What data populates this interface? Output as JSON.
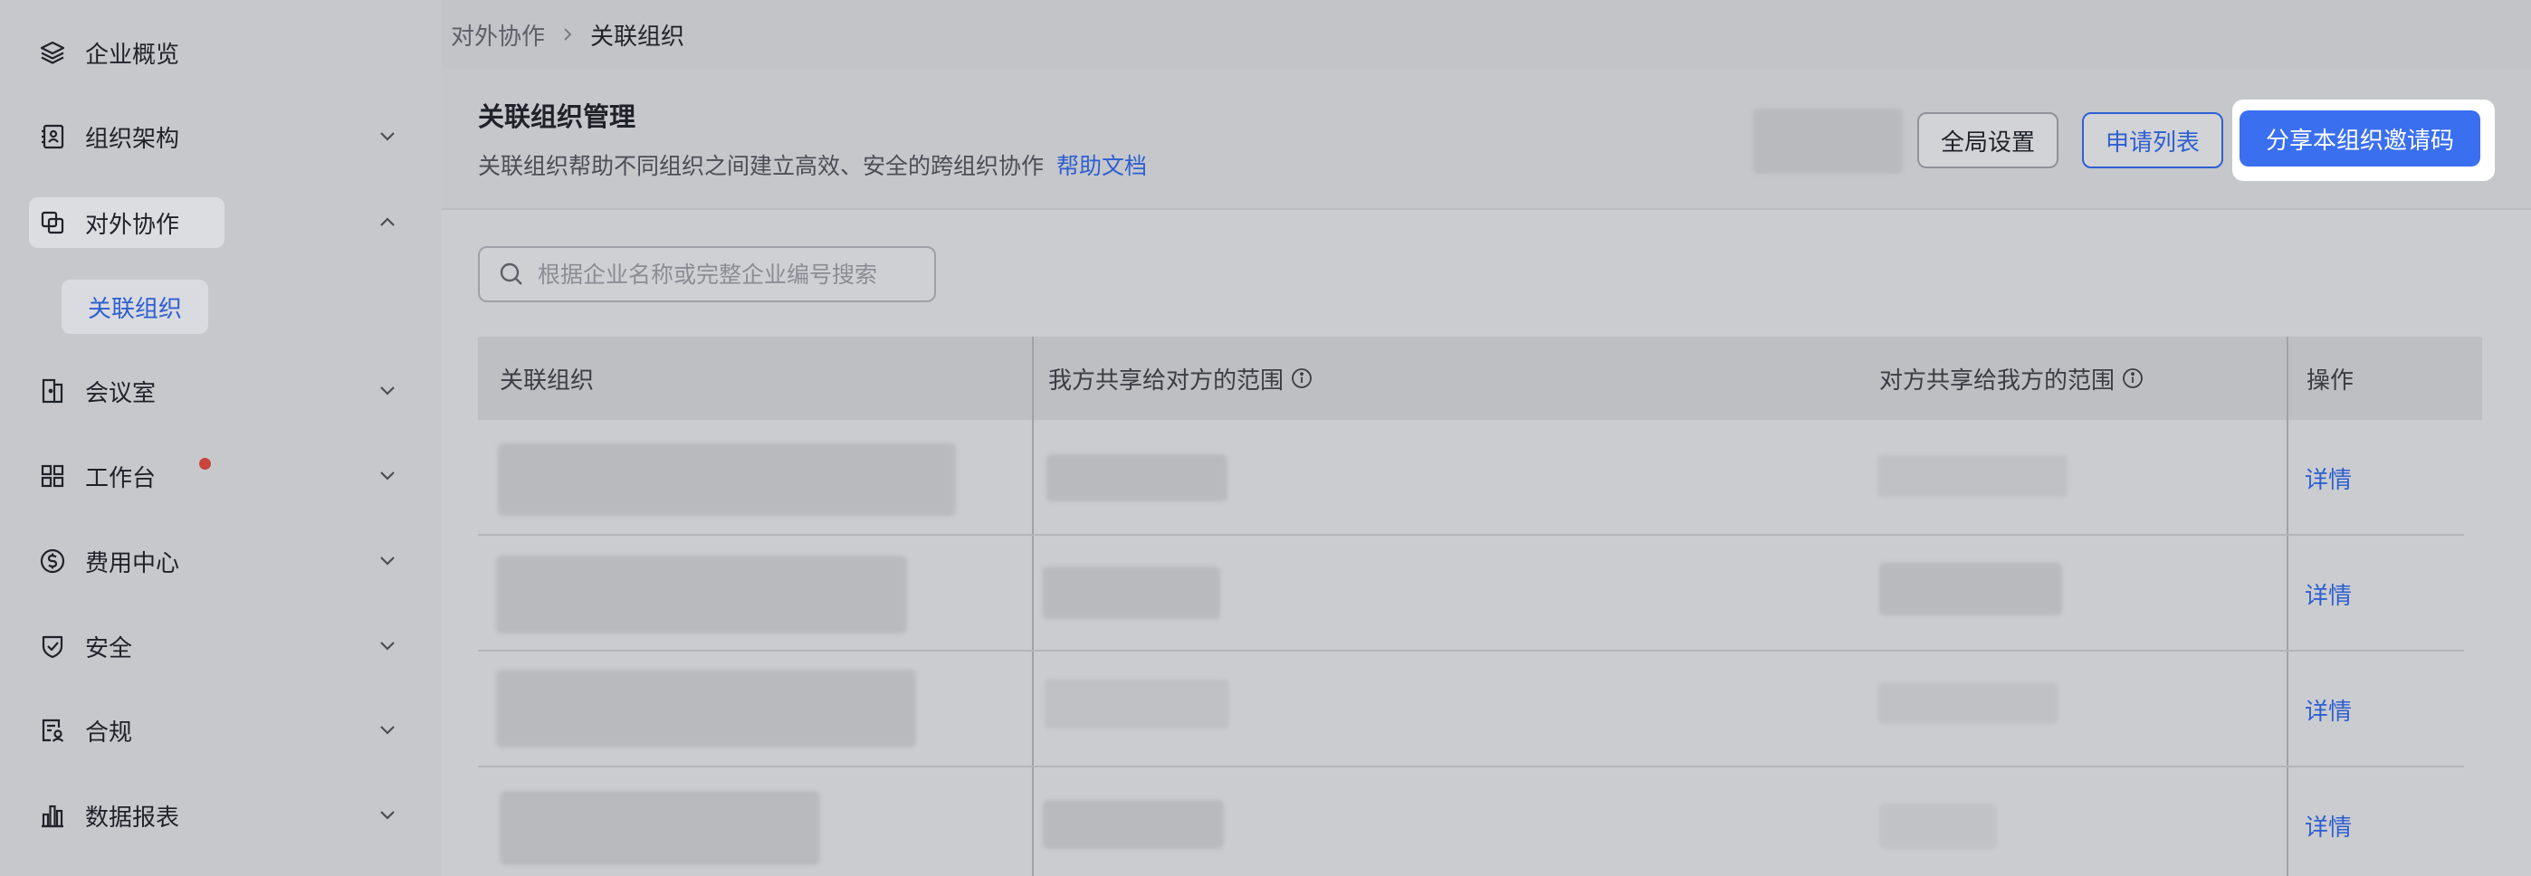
{
  "sidebar": {
    "items": [
      {
        "label": "企业概览",
        "icon": "layers-icon"
      },
      {
        "label": "组织架构",
        "icon": "org-chart-icon"
      },
      {
        "label": "对外协作",
        "icon": "collaboration-icon"
      },
      {
        "label": "会议室",
        "icon": "meeting-room-icon"
      },
      {
        "label": "工作台",
        "icon": "grid-apps-icon"
      },
      {
        "label": "费用中心",
        "icon": "dollar-coin-icon"
      },
      {
        "label": "安全",
        "icon": "shield-check-icon"
      },
      {
        "label": "合规",
        "icon": "compliance-doc-icon"
      },
      {
        "label": "数据报表",
        "icon": "bar-chart-icon"
      }
    ],
    "sub_item_label": "关联组织"
  },
  "breadcrumb": {
    "parent": "对外协作",
    "current": "关联组织"
  },
  "header": {
    "title": "关联组织管理",
    "description": "关联组织帮助不同组织之间建立高效、安全的跨组织协作",
    "help_link": "帮助文档",
    "global_settings_button": "全局设置",
    "apply_list_button": "申请列表",
    "share_invite_button": "分享本组织邀请码"
  },
  "search": {
    "placeholder": "根据企业名称或完整企业编号搜索"
  },
  "table": {
    "columns": [
      "关联组织",
      "我方共享给对方的范围",
      "对方共享给我方的范围",
      "操作"
    ],
    "rows": [
      {
        "action": "详情"
      },
      {
        "action": "详情"
      },
      {
        "action": "详情"
      },
      {
        "action": "详情"
      }
    ]
  },
  "colors": {
    "accent": "#3a6ff0",
    "link": "#2e5fd1",
    "badge": "#c8443d"
  }
}
